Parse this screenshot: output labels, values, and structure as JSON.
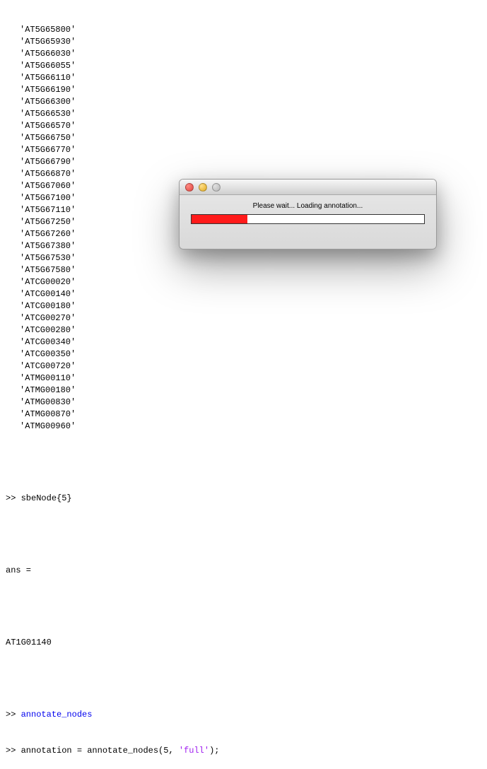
{
  "terminal": {
    "genes": [
      "'AT5G65800'",
      "'AT5G65930'",
      "'AT5G66030'",
      "'AT5G66055'",
      "'AT5G66110'",
      "'AT5G66190'",
      "'AT5G66300'",
      "'AT5G66530'",
      "'AT5G66570'",
      "'AT5G66750'",
      "'AT5G66770'",
      "'AT5G66790'",
      "'AT5G66870'",
      "'AT5G67060'",
      "'AT5G67100'",
      "'AT5G67110'",
      "'AT5G67250'",
      "'AT5G67260'",
      "'AT5G67380'",
      "'AT5G67530'",
      "'AT5G67580'",
      "'ATCG00020'",
      "'ATCG00140'",
      "'ATCG00180'",
      "'ATCG00270'",
      "'ATCG00280'",
      "'ATCG00340'",
      "'ATCG00350'",
      "'ATCG00720'",
      "'ATMG00110'",
      "'ATMG00180'",
      "'ATMG00830'",
      "'ATMG00870'",
      "'ATMG00960'"
    ],
    "prompt": ">> ",
    "cmd1": "sbeNode{5}",
    "ans_label": "ans =",
    "ans_value": "AT1G01140",
    "cmd2": "annotate_nodes",
    "cmd3_pre": "annotation = annotate_nodes(5, ",
    "cmd3_str": "'full'",
    "cmd3_post": ");"
  },
  "dialog": {
    "message": "Please wait... Loading annotation...",
    "progress_percent": 24
  }
}
